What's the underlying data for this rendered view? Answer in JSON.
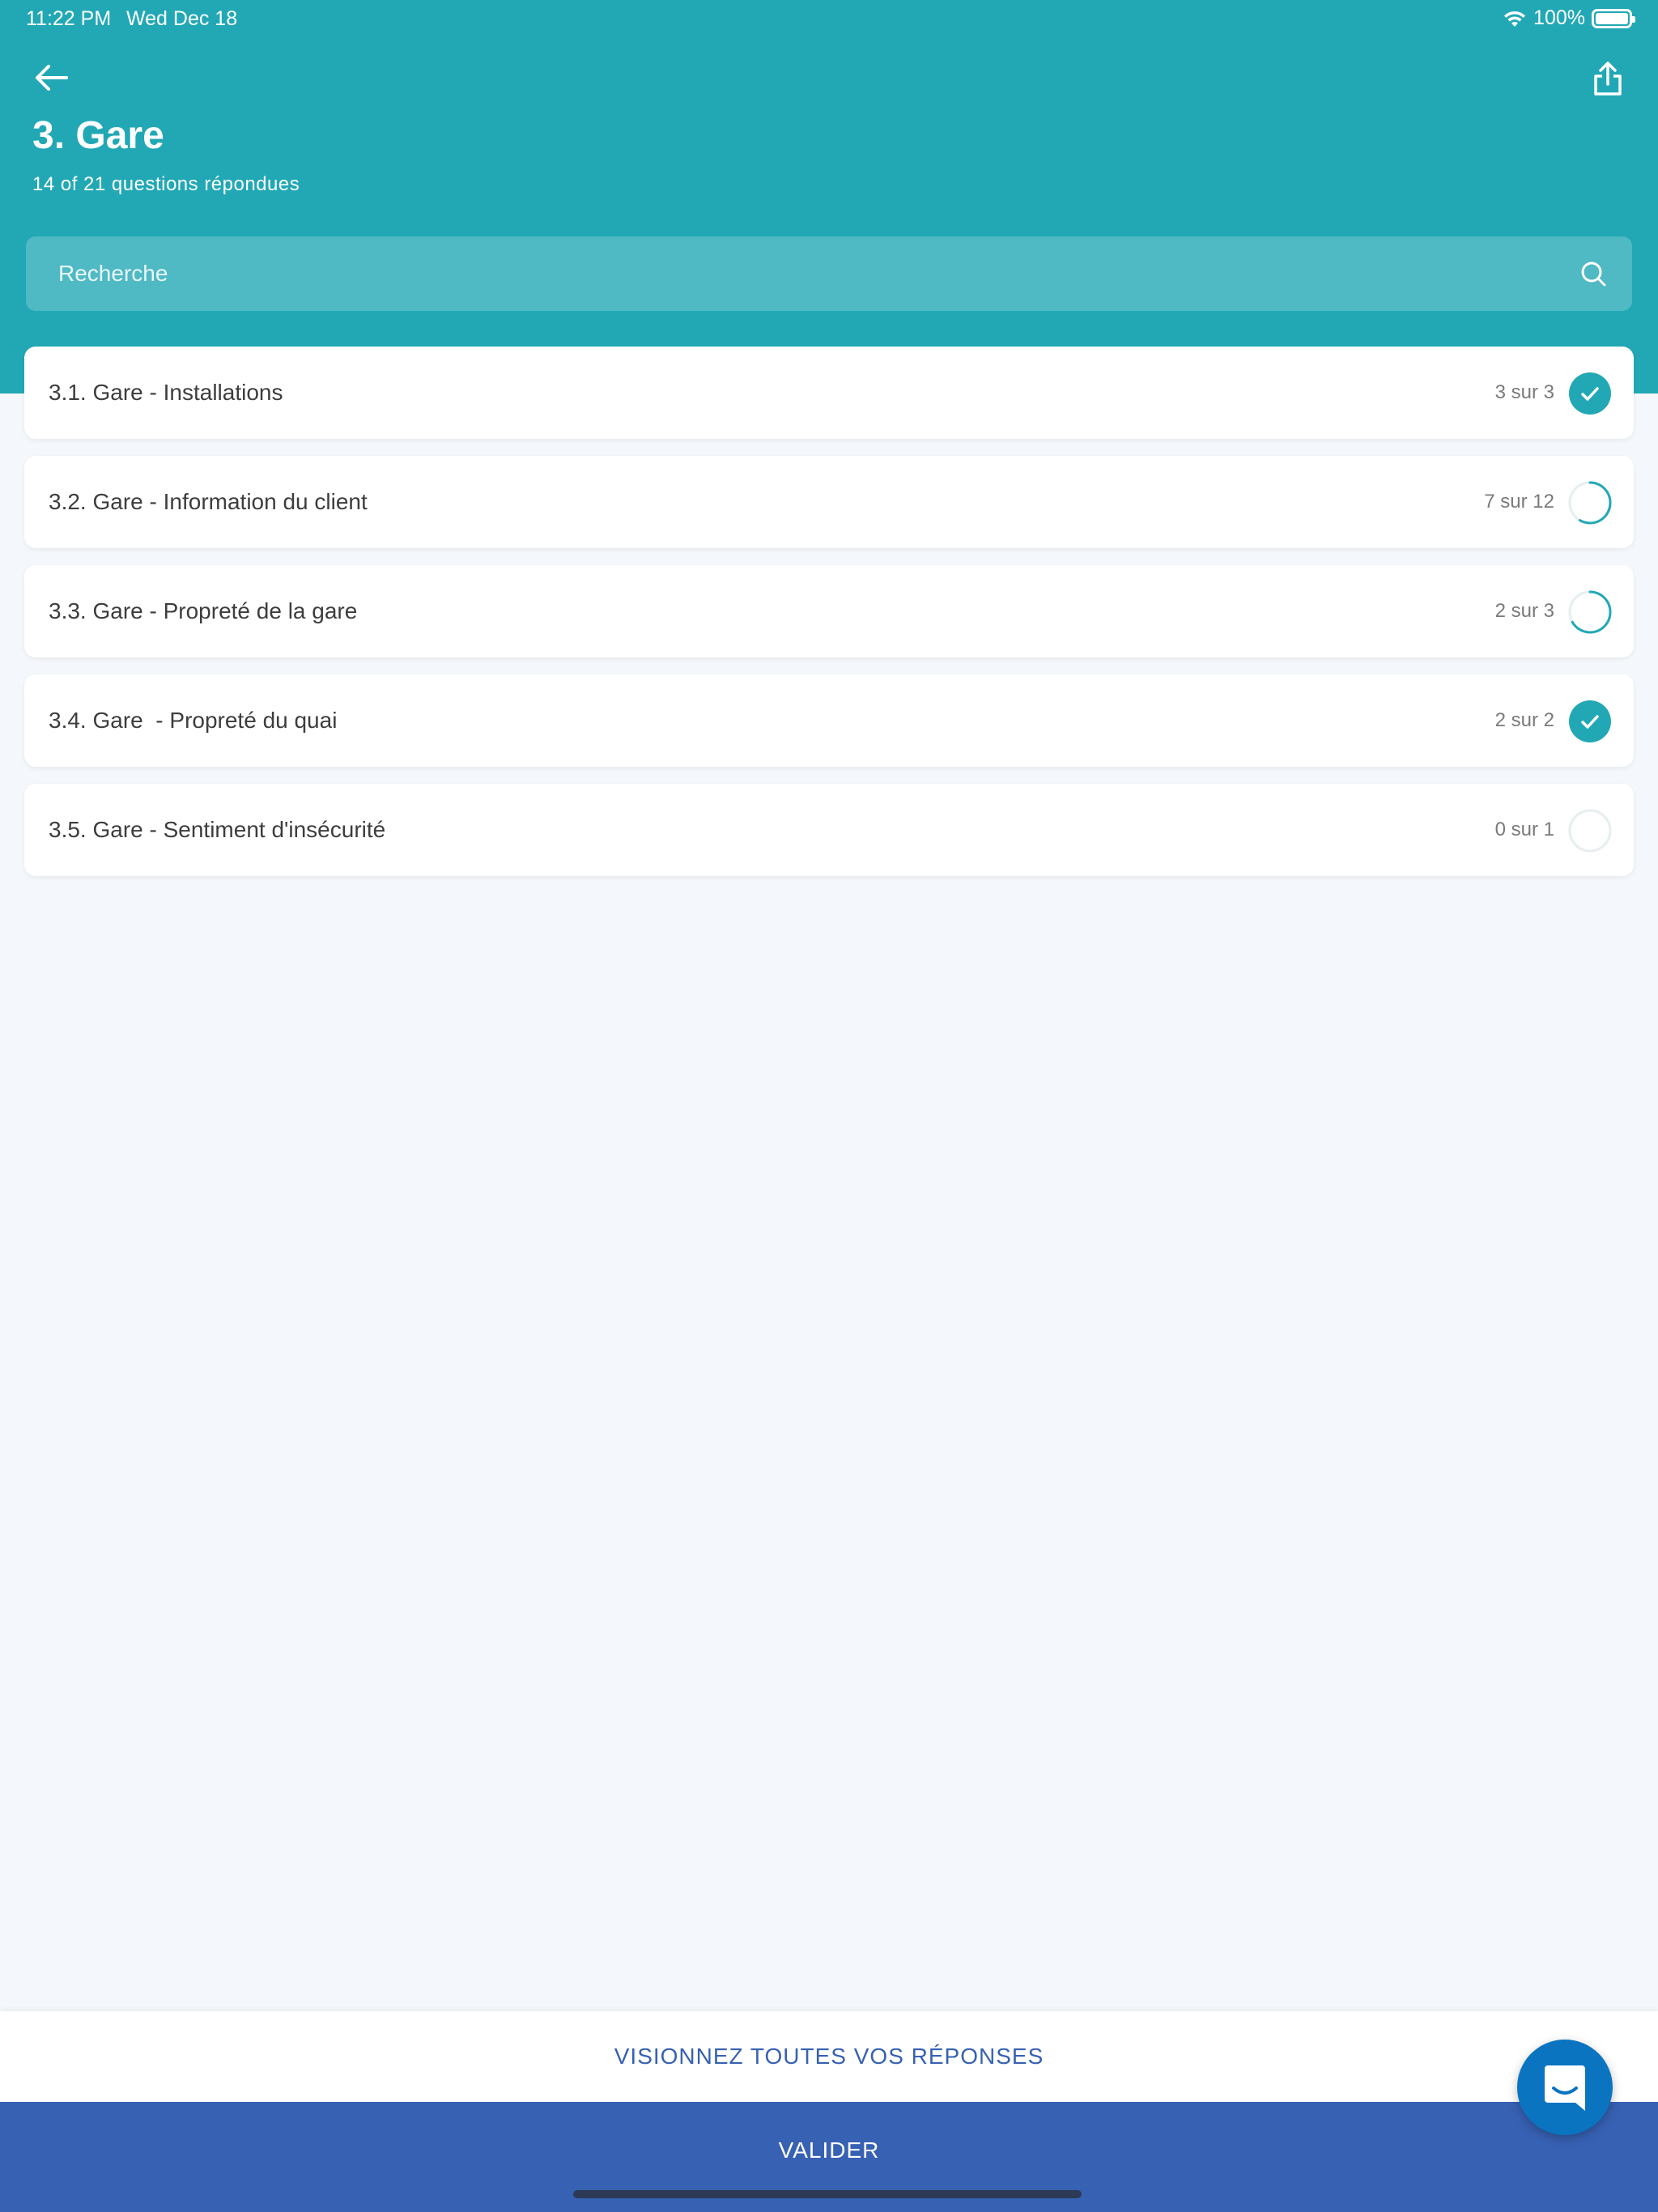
{
  "status_bar": {
    "time": "11:22 PM",
    "date": "Wed Dec 18",
    "battery_percent": "100%"
  },
  "header": {
    "title": "3. Gare",
    "subtitle": "14 of 21 questions répondues",
    "back_icon": "arrow-left-icon",
    "share_icon": "share-icon"
  },
  "search": {
    "placeholder": "Recherche",
    "value": "",
    "icon": "search-icon"
  },
  "sections": [
    {
      "title": "3.1. Gare - Installations",
      "count": "3 sur 3",
      "answered": 3,
      "total": 3,
      "status": "complete"
    },
    {
      "title": "3.2. Gare - Information du client",
      "count": "7 sur 12",
      "answered": 7,
      "total": 12,
      "status": "partial"
    },
    {
      "title": "3.3. Gare - Propreté de la gare",
      "count": "2 sur 3",
      "answered": 2,
      "total": 3,
      "status": "partial"
    },
    {
      "title": "3.4. Gare  - Propreté du quai",
      "count": "2 sur 2",
      "answered": 2,
      "total": 2,
      "status": "complete"
    },
    {
      "title": "3.5. Gare - Sentiment d'insécurité",
      "count": "0 sur 1",
      "answered": 0,
      "total": 1,
      "status": "empty"
    }
  ],
  "footer": {
    "view_all_label": "VISIONNEZ TOUTES VOS RÉPONSES",
    "validate_label": "VALIDER",
    "chat_icon": "chat-icon"
  },
  "colors": {
    "header_bg": "#22a8b5",
    "accent": "#22a8b5",
    "primary_blue": "#3761b3",
    "fab_blue": "#0a74c1",
    "page_bg": "#f4f7fb"
  }
}
